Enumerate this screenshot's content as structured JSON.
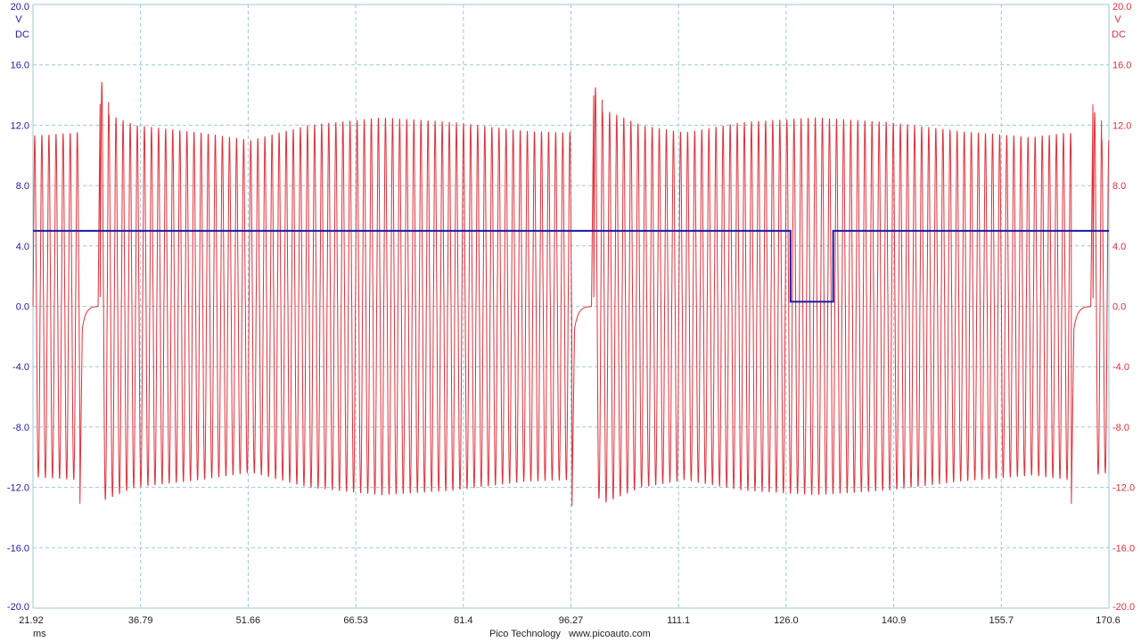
{
  "chart_data": {
    "type": "line",
    "x_unit": "ms",
    "xlim": [
      21.92,
      170.6
    ],
    "x_ticks": [
      "21.92",
      "36.79",
      "51.66",
      "66.53",
      "81.4",
      "96.27",
      "111.1",
      "126.0",
      "140.9",
      "155.7",
      "170.6"
    ],
    "y_left": {
      "unit": "V",
      "coupling": "DC",
      "ylim": [
        -20,
        20
      ],
      "ticks": [
        "20.0",
        "16.0",
        "12.0",
        "8.0",
        "4.0",
        "0.0",
        "-4.0",
        "-8.0",
        "-12.0",
        "-16.0",
        "-20.0"
      ],
      "color": "#1a1aa6"
    },
    "y_right": {
      "unit": "V",
      "coupling": "DC",
      "ylim": [
        -20,
        20
      ],
      "ticks": [
        "20.0",
        "16.0",
        "12.0",
        "8.0",
        "4.0",
        "0.0",
        "-4.0",
        "-8.0",
        "-12.0",
        "-16.0",
        "-20.0"
      ],
      "color": "#e0303a"
    },
    "grid": true,
    "series": [
      {
        "channel": "B",
        "color": "#e0303a",
        "shape": "sine-like oscillation with two missing-tooth gaps",
        "amplitude_envelope_ms": [
          21.92,
          28,
          31,
          36,
          45,
          52,
          60,
          70,
          80,
          90,
          96,
          101,
          106,
          112,
          120,
          130,
          140,
          150,
          160,
          165,
          170.6
        ],
        "amplitude_envelope_v": [
          11.3,
          11.5,
          13.0,
          12.0,
          11.5,
          11.0,
          12.0,
          12.5,
          12.2,
          11.6,
          11.5,
          13.0,
          12.0,
          11.5,
          12.2,
          12.5,
          12.2,
          11.6,
          11.2,
          11.5,
          11.0
        ],
        "cycle_period_ms": 0.98,
        "gaps_ms": [
          [
            28.4,
            31.2
          ],
          [
            96.4,
            99.4
          ],
          [
            165.4,
            168.4
          ]
        ],
        "gap_shape_v": [
          -12,
          0,
          14
        ]
      },
      {
        "channel": "A",
        "color": "#1a1aa6",
        "shape": "flat line with a low pulse",
        "x": [
          21.92,
          126.6,
          126.6,
          132.5,
          132.5,
          170.6
        ],
        "y": [
          5.0,
          5.0,
          0.3,
          0.3,
          5.0,
          5.0
        ]
      }
    ]
  },
  "footer": {
    "time_unit": "ms",
    "credit": "Pico Technology   www.picoauto.com"
  }
}
